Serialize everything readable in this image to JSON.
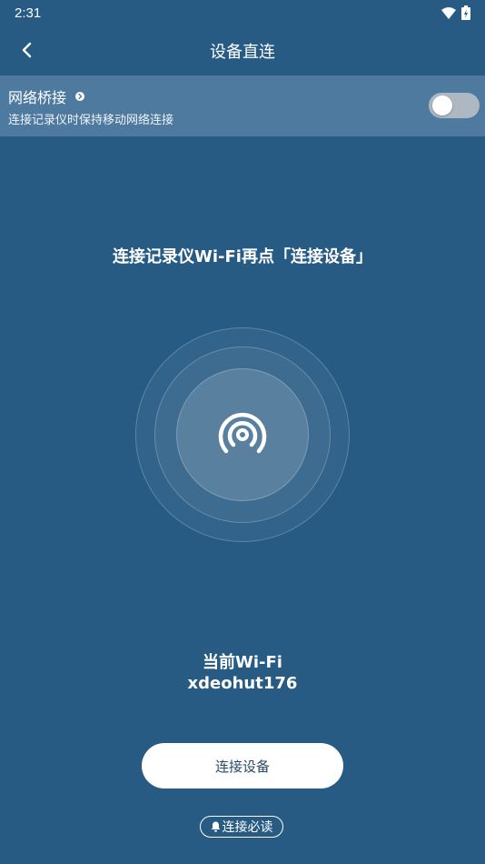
{
  "status_bar": {
    "time": "2:31",
    "icons": [
      "wifi-icon",
      "battery-icon"
    ]
  },
  "header": {
    "title": "设备直连",
    "back_icon": "chevron-left-icon"
  },
  "network_bridge": {
    "title": "网络桥接",
    "description": "连接记录仪时保持移动网络连接",
    "toggle_on": false
  },
  "main": {
    "instruction": "连接记录仪Wi-Fi再点「连接设备」",
    "icon": "hotspot-icon",
    "current_wifi_label": "当前Wi-Fi",
    "current_wifi_name": "xdeohut176"
  },
  "actions": {
    "connect_label": "连接设备",
    "guide_label": "连接必读",
    "guide_icon": "bell-icon"
  },
  "colors": {
    "background": "#275b84",
    "bridge_row": "#4e7aa0",
    "toggle_off": "#aeb8c2",
    "button_text": "#2a4a66"
  }
}
